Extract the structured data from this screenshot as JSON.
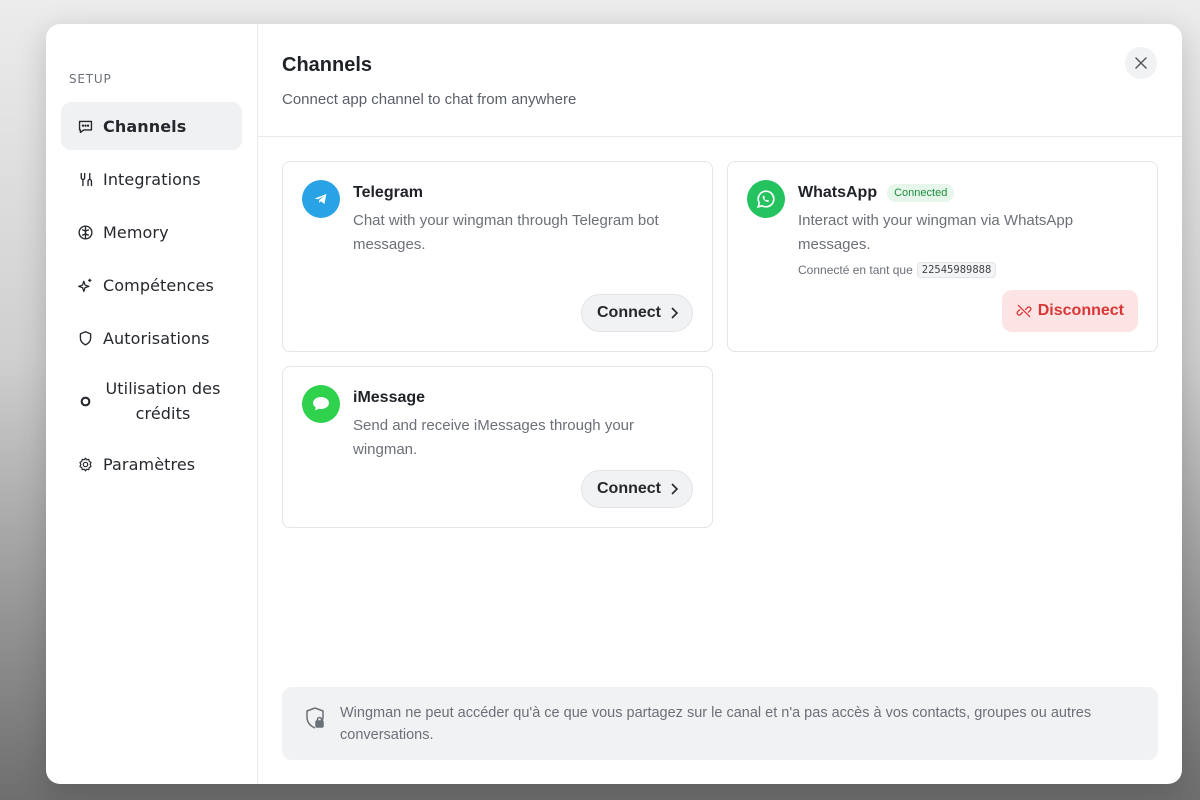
{
  "sidebar": {
    "section_label": "SETUP",
    "items": [
      {
        "label": "Channels",
        "icon": "chat-icon",
        "active": true
      },
      {
        "label": "Integrations",
        "icon": "integrations-icon"
      },
      {
        "label": "Memory",
        "icon": "brain-icon"
      },
      {
        "label": "Compétences",
        "icon": "sparkle-icon"
      },
      {
        "label": "Autorisations",
        "icon": "shield-icon"
      },
      {
        "label": "Utilisation des crédits",
        "icon": "dot-icon"
      },
      {
        "label": "Paramètres",
        "icon": "gear-icon"
      }
    ]
  },
  "header": {
    "title": "Channels",
    "subtitle": "Connect app channel to chat from anywhere"
  },
  "channels": {
    "telegram": {
      "name": "Telegram",
      "description": "Chat with your wingman through Telegram bot messages.",
      "button": "Connect",
      "icon_color": "#2aa3e6"
    },
    "whatsapp": {
      "name": "WhatsApp",
      "badge": "Connected",
      "description": "Interact with your wingman via WhatsApp messages.",
      "connected_as_label": "Connecté en tant que",
      "phone": "22545989888",
      "button": "Disconnect",
      "icon_color": "#25c35f"
    },
    "imessage": {
      "name": "iMessage",
      "description": "Send and receive iMessages through your wingman.",
      "button": "Connect",
      "icon_color": "#2fd14d"
    }
  },
  "notice": {
    "text": "Wingman ne peut accéder qu'à ce que vous partagez sur le canal et n'a pas accès à vos contacts, groupes ou autres conversations."
  },
  "colors": {
    "danger": "#d93636",
    "success": "#1e8e3e"
  }
}
